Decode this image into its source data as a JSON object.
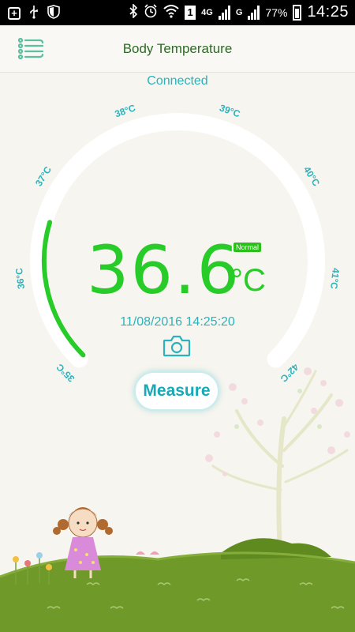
{
  "status_bar": {
    "icons": [
      "add-icon",
      "usb-icon",
      "shield-icon",
      "bluetooth-icon",
      "alarm-icon",
      "wifi-icon",
      "sim-1-icon",
      "signal-icon",
      "battery-charging-icon"
    ],
    "sim_slot": "1",
    "network_type": "4G",
    "g_label": "G",
    "battery_percent": "77%",
    "time": "14:25"
  },
  "header": {
    "title": "Body Temperature",
    "menu_icon": "menu-list-icon"
  },
  "connection_status": "Connected",
  "gauge": {
    "scale": [
      "35°C",
      "36°C",
      "37°C",
      "38°C",
      "39°C",
      "40°C",
      "41°C",
      "42°C"
    ],
    "min": 35,
    "max": 42,
    "track_color": "#ffffff",
    "fill_color": "#28cc28",
    "fill_value": 36.6
  },
  "reading": {
    "value": "36.6",
    "unit": "°C",
    "status": "Normal",
    "timestamp": "11/08/2016 14:25:20"
  },
  "camera_icon": "camera-icon",
  "measure_button": "Measure",
  "colors": {
    "accent": "#2ab3bd",
    "temperature_green": "#28cc28",
    "title_green": "#2d6a26",
    "grass": "#6f9a2a"
  }
}
